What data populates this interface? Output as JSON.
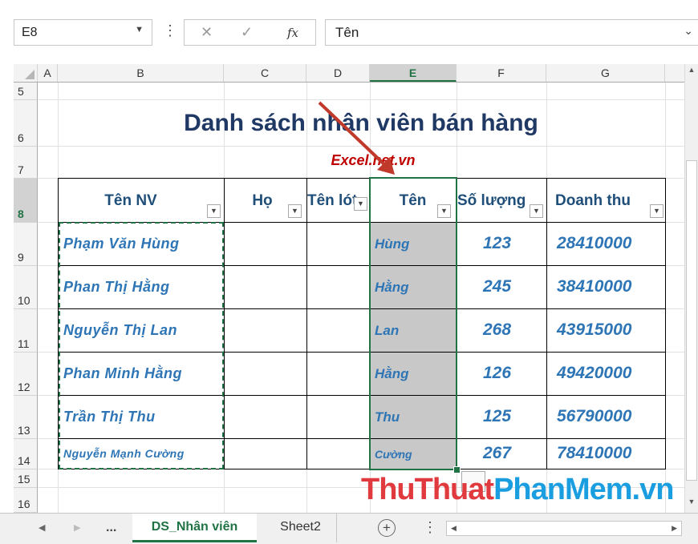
{
  "formula_bar": {
    "name_box": "E8",
    "fx_label": "fx",
    "value": "Tên",
    "cancel_symbol": "✕",
    "enter_symbol": "✓"
  },
  "columns": [
    "A",
    "B",
    "C",
    "D",
    "E",
    "F",
    "G"
  ],
  "rows": [
    "5",
    "6",
    "7",
    "8",
    "9",
    "10",
    "11",
    "12",
    "13",
    "14",
    "15",
    "16"
  ],
  "sheet": {
    "title": "Danh sách nhân viên bán hàng",
    "subtitle": "Excel.net.vn",
    "headers": [
      "Tên NV",
      "Họ",
      "Tên lót",
      "Tên",
      "Số lượng",
      "Doanh thu"
    ],
    "records": [
      {
        "full_name": "Phạm Văn Hùng",
        "ten": "Hùng",
        "so_luong": "123",
        "doanh_thu": "28410000"
      },
      {
        "full_name": "Phan Thị Hằng",
        "ten": "Hằng",
        "so_luong": "245",
        "doanh_thu": "38410000"
      },
      {
        "full_name": "Nguyễn Thị Lan",
        "ten": "Lan",
        "so_luong": "268",
        "doanh_thu": "43915000"
      },
      {
        "full_name": "Phan Minh Hằng",
        "ten": "Hằng",
        "so_luong": "126",
        "doanh_thu": "49420000"
      },
      {
        "full_name": "Trần Thị Thu",
        "ten": "Thu",
        "so_luong": "125",
        "doanh_thu": "56790000"
      },
      {
        "full_name": "Nguyễn Mạnh Cường",
        "ten": "Cường",
        "so_luong": "267",
        "doanh_thu": "78410000"
      }
    ]
  },
  "tabs": {
    "ellipsis": "...",
    "active": "DS_Nhân viên",
    "other": "Sheet2",
    "add_symbol": "+"
  },
  "watermark": {
    "part1": "ThuThuat",
    "part2": "PhanMem.vn"
  },
  "colors": {
    "accent": "#217346",
    "title": "#1f3864",
    "subtitle": "#c00000",
    "data": "#2e75b6",
    "arrow": "#c0392b"
  }
}
